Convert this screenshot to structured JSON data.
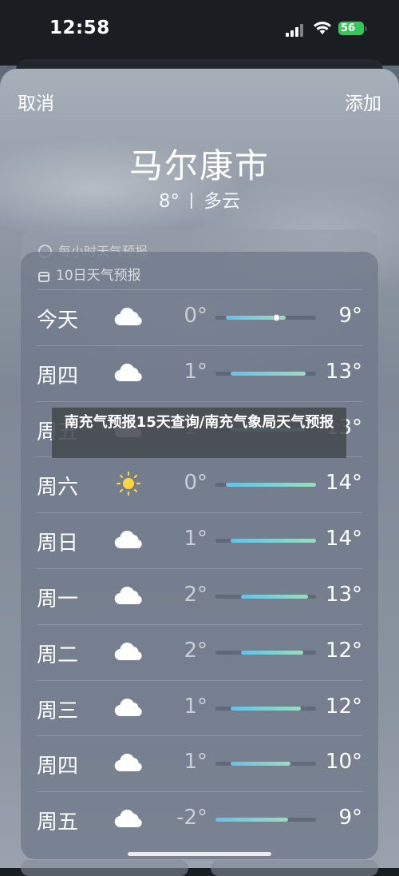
{
  "status_bar": {
    "time": "12:58",
    "battery": "56"
  },
  "nav": {
    "cancel": "取消",
    "add": "添加"
  },
  "location": {
    "city": "马尔康市",
    "temp": "8°",
    "condition": "多云"
  },
  "hourly": {
    "title": "每小时天气预报"
  },
  "forecast": {
    "title": "10日天气预报",
    "days": [
      {
        "day": "今天",
        "icon": "cloud-icon",
        "low": "0°",
        "high": "9°",
        "bar_start": 0.1,
        "bar_end": 0.7,
        "current": 0.6
      },
      {
        "day": "周四",
        "icon": "cloud-icon",
        "low": "1°",
        "high": "13°",
        "bar_start": 0.15,
        "bar_end": 0.9
      },
      {
        "day": "周五",
        "icon": "cloud-icon",
        "low": "1°",
        "high": "13°",
        "bar_start": 0.15,
        "bar_end": 0.9
      },
      {
        "day": "周六",
        "icon": "sun-icon",
        "low": "0°",
        "high": "14°",
        "bar_start": 0.1,
        "bar_end": 1.0
      },
      {
        "day": "周日",
        "icon": "cloud-icon",
        "low": "1°",
        "high": "14°",
        "bar_start": 0.15,
        "bar_end": 1.0
      },
      {
        "day": "周一",
        "icon": "cloud-icon",
        "low": "2°",
        "high": "13°",
        "bar_start": 0.25,
        "bar_end": 0.92
      },
      {
        "day": "周二",
        "icon": "cloud-icon",
        "low": "2°",
        "high": "12°",
        "bar_start": 0.25,
        "bar_end": 0.87
      },
      {
        "day": "周三",
        "icon": "cloud-icon",
        "low": "1°",
        "high": "12°",
        "bar_start": 0.15,
        "bar_end": 0.85
      },
      {
        "day": "周四",
        "icon": "cloud-icon",
        "low": "1°",
        "high": "10°",
        "bar_start": 0.15,
        "bar_end": 0.75
      },
      {
        "day": "周五",
        "icon": "cloud-icon",
        "low": "-2°",
        "high": "9°",
        "bar_start": 0.0,
        "bar_end": 0.72
      }
    ]
  },
  "banner": {
    "text": "南充气预报15天查询/南充气象局天气预报"
  }
}
